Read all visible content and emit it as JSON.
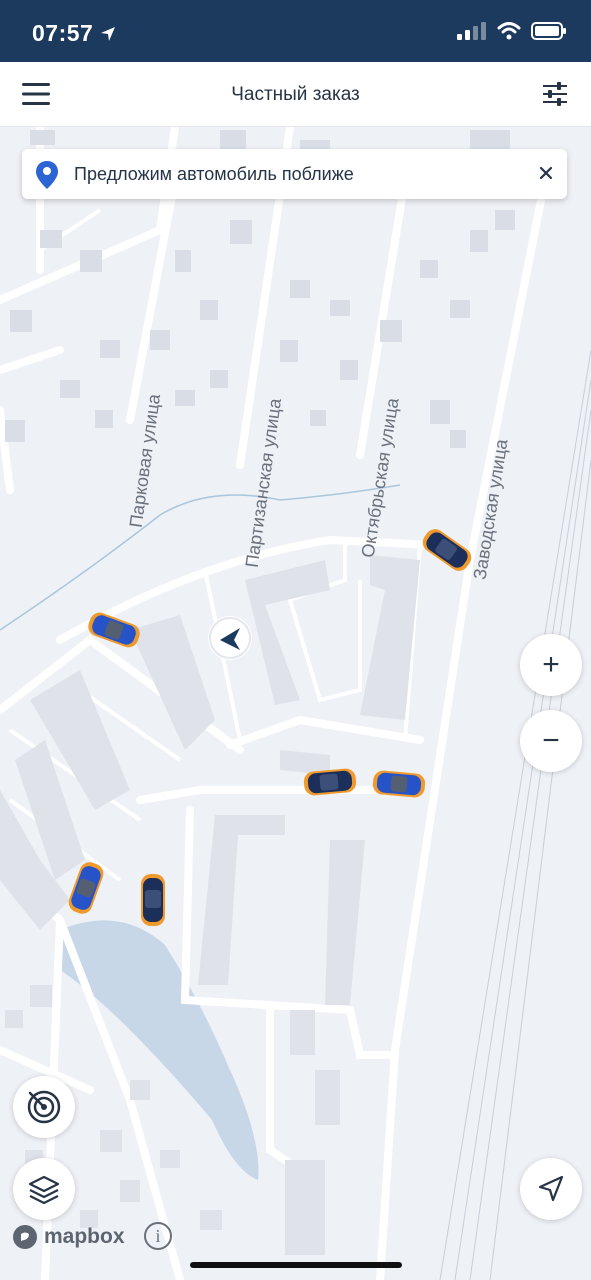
{
  "status_bar": {
    "time": "07:57"
  },
  "header": {
    "title": "Частный заказ"
  },
  "banner": {
    "text": "Предложим автомобиль поближе"
  },
  "map": {
    "streets": {
      "parkovaya": "Парковая улица",
      "partizanskaya": "Партизанская улица",
      "oktyabrskaya": "Октябрьская улица",
      "zavodskaya": "Заводская улица"
    },
    "attribution": {
      "logo_text": "mapbox",
      "info_label": "i"
    }
  },
  "controls": {
    "zoom_in": "+",
    "zoom_out": "−"
  },
  "icons": {
    "menu": "hamburger-menu-icon",
    "filters": "sliders-icon",
    "pin": "location-pin-icon",
    "close": "close-icon",
    "radar": "radar-icon",
    "layers": "layers-icon",
    "navigate": "navigation-arrow-icon"
  },
  "colors": {
    "status_bar": "#1c3a5e",
    "pin": "#2c64d4",
    "car_blue": "#2654c8",
    "car_orange": "#f09a2c",
    "water": "#c7d7e8"
  }
}
